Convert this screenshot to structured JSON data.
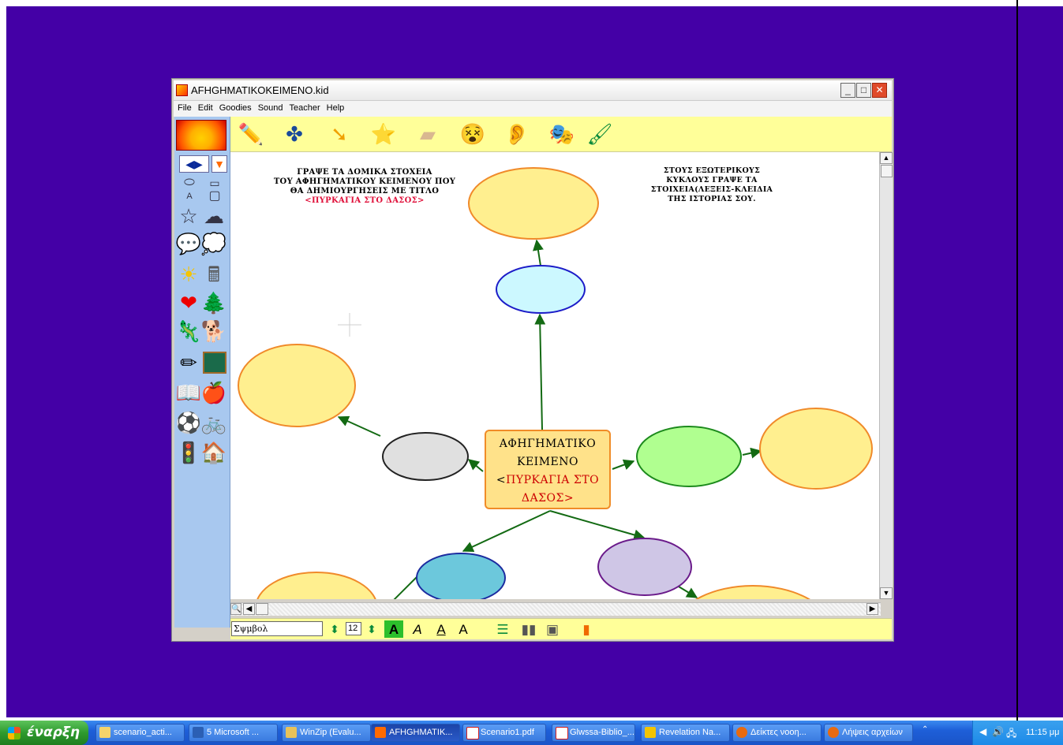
{
  "window": {
    "title": "AFHGHMATIKOKEIMENO.kid",
    "controls": [
      "_",
      "□",
      "✕"
    ]
  },
  "menu": [
    "File",
    "Edit",
    "Goodies",
    "Sound",
    "Teacher",
    "Help"
  ],
  "canvas": {
    "note_left": [
      "ΓΡΑΨΕ ΤΑ ΔΟΜΙΚΑ ΣΤΟΧΕΙΑ",
      "ΤΟΥ ΑΦΗΓΗΜΑΤΙΚΟΥ ΚΕΙΜΕΝΟΥ ΠΟΥ",
      "ΘΑ ΔΗΜΙΟΥΡΓΗΣΕΙΣ ΜΕ ΤΙΤΛΟ",
      "<ΠΥΡΚΑΓΙΑ ΣΤΟ ΔΑΣΟΣ>"
    ],
    "note_right": [
      "ΣΤΟΥΣ ΕΞΩΤΕΡΙΚΟΥΣ",
      "ΚΥΚΛΟΥΣ ΓΡΑΨΕ ΤΑ",
      "ΣΤΟΙΧΕΙΑ(ΛΕΞΕΙΣ-ΚΛΕΙΔΙΑ",
      "ΤΗΣ ΙΣΤΟΡΙΑΣ ΣΟΥ."
    ],
    "center": [
      "ΑΦΗΓΗΜΑΤΙΚΟ",
      "ΚΕΙΜΕΝΟ",
      "<",
      "ΠΥΡΚΑΓΙΑ ΣΤΟ",
      "ΔΑΣΟΣ>"
    ],
    "colors": {
      "outer_fill": "#ffef8f",
      "outer_stroke": "#f08a2a",
      "arrow": "#136a13",
      "center_fill": "#ffe28a"
    }
  },
  "bottombar": {
    "font_name": "Σψμβολ",
    "font_size": "12",
    "style_buttons": [
      "A",
      "A",
      "A",
      "A"
    ]
  },
  "taskbar": {
    "start_label": "έναρξη",
    "tasks": [
      {
        "label": "scenario_acti...",
        "icon": "folder-icon",
        "color": "#f5d36b"
      },
      {
        "label": "5 Microsoft ...",
        "icon": "word-icon",
        "color": "#2b5fb4"
      },
      {
        "label": "WinZip (Evalu...",
        "icon": "winzip-icon",
        "color": "#e8c25a"
      },
      {
        "label": "AFHGHMATIK...",
        "icon": "kidpix-icon",
        "color": "#ff6a00"
      },
      {
        "label": "Scenario1.pdf",
        "icon": "pdf-icon",
        "color": "#d62020"
      },
      {
        "label": "Glwssa-Biblio_...",
        "icon": "pdf-icon",
        "color": "#d62020"
      },
      {
        "label": "Revelation Na...",
        "icon": "revelation-icon",
        "color": "#f3c400"
      },
      {
        "label": "Δείκτες νοοη...",
        "icon": "firefox-icon",
        "color": "#e86a10"
      },
      {
        "label": "Λήψεις αρχείων",
        "icon": "firefox-icon",
        "color": "#e86a10"
      }
    ],
    "clock": "11:15 μμ"
  }
}
